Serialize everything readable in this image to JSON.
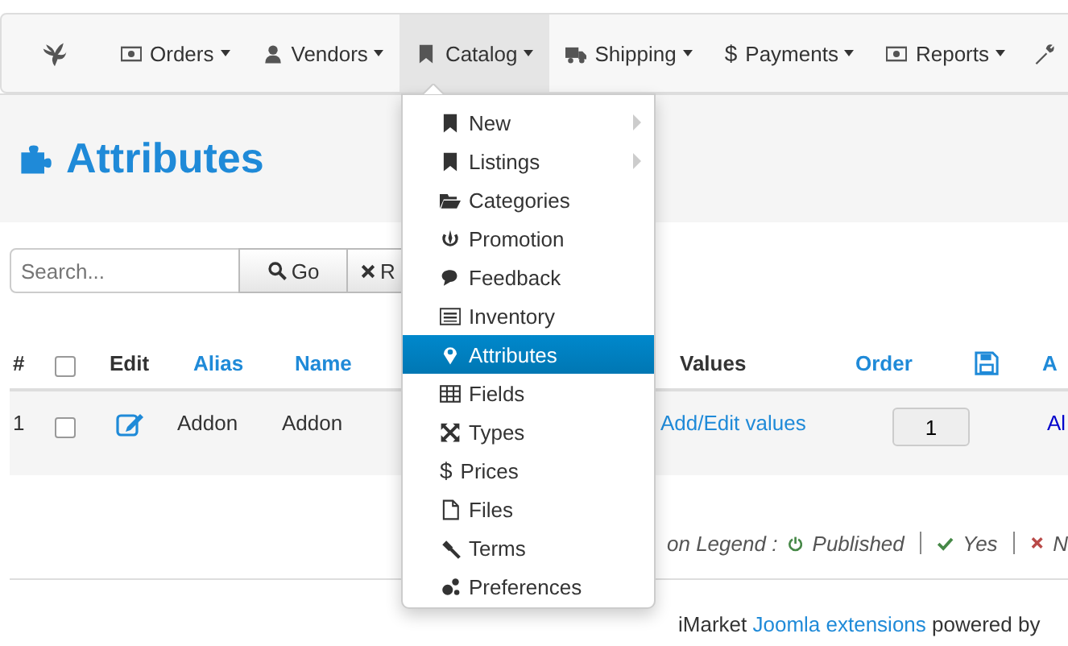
{
  "navbar": {
    "items": [
      {
        "label": "Orders",
        "selected": false
      },
      {
        "label": "Vendors",
        "selected": false
      },
      {
        "label": "Catalog",
        "selected": true
      },
      {
        "label": "Shipping",
        "selected": false
      },
      {
        "label": "Payments",
        "glyph": "$",
        "selected": false
      },
      {
        "label": "Reports",
        "selected": false
      }
    ]
  },
  "catalog_menu": {
    "items": [
      {
        "label": "New",
        "submenu": true,
        "selected": false
      },
      {
        "label": "Listings",
        "submenu": true,
        "selected": false
      },
      {
        "label": "Categories",
        "submenu": false,
        "selected": false
      },
      {
        "label": "Promotion",
        "submenu": false,
        "selected": false
      },
      {
        "label": "Feedback",
        "submenu": false,
        "selected": false
      },
      {
        "label": "Inventory",
        "submenu": false,
        "selected": false
      },
      {
        "label": "Attributes",
        "submenu": false,
        "selected": true
      },
      {
        "label": "Fields",
        "submenu": false,
        "selected": false
      },
      {
        "label": "Types",
        "submenu": false,
        "selected": false
      },
      {
        "label": "Prices",
        "glyph": "$",
        "submenu": false,
        "selected": false
      },
      {
        "label": "Files",
        "submenu": false,
        "selected": false
      },
      {
        "label": "Terms",
        "submenu": false,
        "selected": false
      },
      {
        "label": "Preferences",
        "submenu": false,
        "selected": false
      }
    ]
  },
  "page_title": "Attributes",
  "search": {
    "placeholder": "Search...",
    "go_label": "Go",
    "reset_label": "R"
  },
  "table": {
    "select_all_checked": false,
    "columns": [
      {
        "label": "#",
        "kind": "plain"
      },
      {
        "kind": "checkbox"
      },
      {
        "label": "Edit",
        "kind": "plain"
      },
      {
        "label": "Alias",
        "kind": "link"
      },
      {
        "label": "Name",
        "kind": "link"
      },
      {
        "label": "Values",
        "kind": "plain"
      },
      {
        "label": "Order",
        "kind": "link"
      },
      {
        "kind": "save"
      },
      {
        "label": "A",
        "kind": "link"
      }
    ],
    "rows": [
      {
        "number": "1",
        "checked": false,
        "alias": "Addon",
        "name": "Addon",
        "values": "Add/Edit values",
        "order": "1",
        "column_9": "Al"
      }
    ]
  },
  "legend": {
    "label": "on Legend :",
    "items": [
      {
        "kind": "power",
        "label": "Published",
        "color": "#468847"
      },
      {
        "kind": "check",
        "label": "Yes",
        "color": "#468847"
      },
      {
        "kind": "cross",
        "label": "N",
        "color": "#b94a48"
      }
    ]
  },
  "footer": {
    "before": "iMarket ",
    "link": "Joomla extensions",
    "after": " powered by"
  }
}
